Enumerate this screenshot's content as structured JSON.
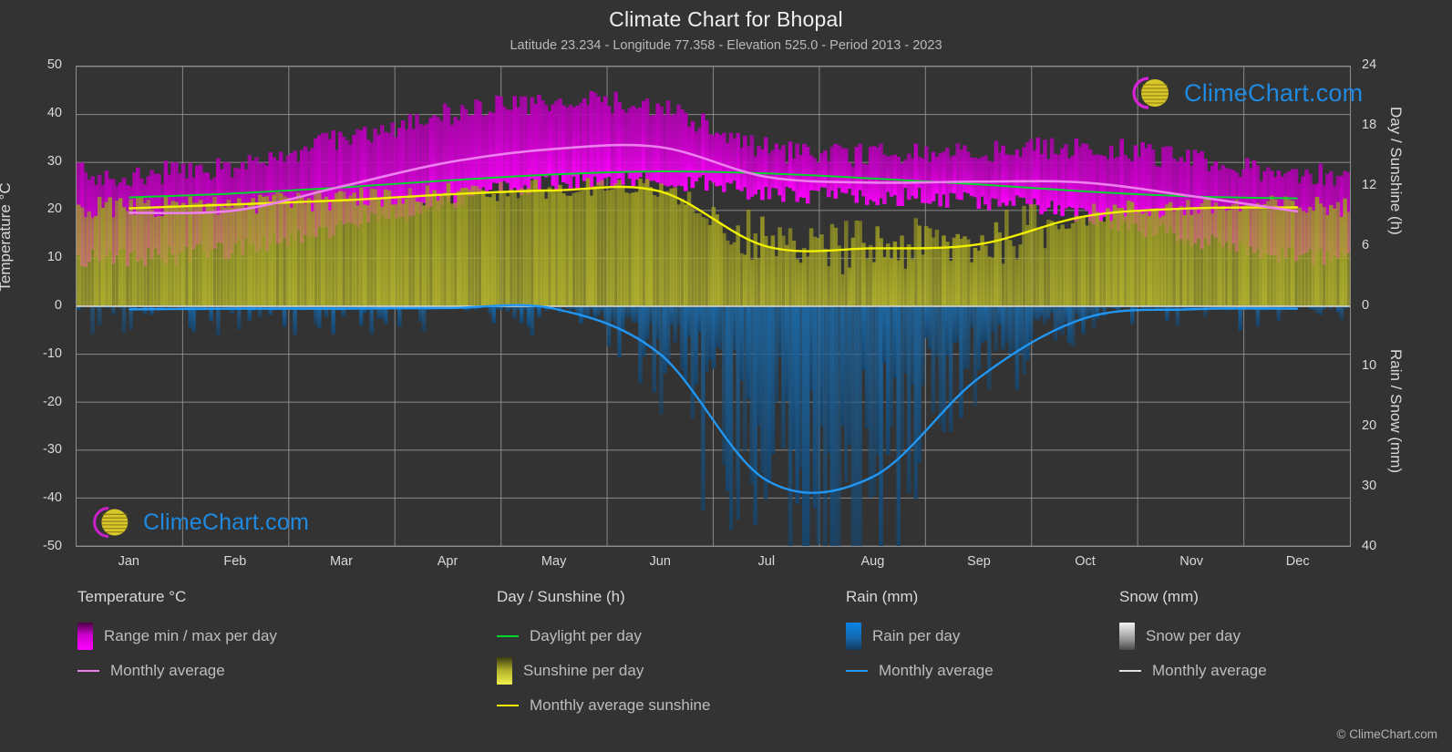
{
  "header": {
    "title": "Climate Chart for Bhopal",
    "subtitle": "Latitude 23.234 - Longitude 77.358 - Elevation 525.0 - Period 2013 - 2023"
  },
  "axes": {
    "left_title": "Temperature °C",
    "right_title_top": "Day / Sunshine (h)",
    "right_title_bottom": "Rain / Snow (mm)",
    "left_ticks": [
      "50",
      "40",
      "30",
      "20",
      "10",
      "0",
      "-10",
      "-20",
      "-30",
      "-40",
      "-50"
    ],
    "right_ticks_top": [
      "24",
      "18",
      "12",
      "6",
      "0"
    ],
    "right_ticks_bottom": [
      "10",
      "20",
      "30",
      "40"
    ],
    "x_ticks": [
      "Jan",
      "Feb",
      "Mar",
      "Apr",
      "May",
      "Jun",
      "Jul",
      "Aug",
      "Sep",
      "Oct",
      "Nov",
      "Dec"
    ]
  },
  "legend": {
    "groups": [
      {
        "title": "Temperature °C",
        "items": [
          {
            "label": "Range min / max per day",
            "marker": "gradient-box",
            "color": "#ff00ff"
          },
          {
            "label": "Monthly average",
            "marker": "line",
            "color": "#ee7fee"
          }
        ]
      },
      {
        "title": "Day / Sunshine (h)",
        "items": [
          {
            "label": "Daylight per day",
            "marker": "line",
            "color": "#00d92b"
          },
          {
            "label": "Sunshine per day",
            "marker": "gradient-box",
            "color": "#f2f24d"
          },
          {
            "label": "Monthly average sunshine",
            "marker": "line",
            "color": "#f0f000"
          }
        ]
      },
      {
        "title": "Rain (mm)",
        "items": [
          {
            "label": "Rain per day",
            "marker": "gradient-box",
            "color": "#0a84e8"
          },
          {
            "label": "Monthly average",
            "marker": "line",
            "color": "#2196f3"
          }
        ]
      },
      {
        "title": "Snow (mm)",
        "items": [
          {
            "label": "Snow per day",
            "marker": "gradient-box",
            "color": "#e8e8e8"
          },
          {
            "label": "Monthly average",
            "marker": "line",
            "color": "#e0e0e0"
          }
        ]
      }
    ]
  },
  "watermark": {
    "text": "ClimeChart.com"
  },
  "footer": {
    "copyright": "© ClimeChart.com"
  },
  "chart_data": {
    "type": "area",
    "title": "Climate Chart for Bhopal",
    "subtitle": "Latitude 23.234 - Longitude 77.358 - Elevation 525.0 - Period 2013 - 2023",
    "xlabel": "",
    "ylabel": "Temperature °C",
    "categories": [
      "Jan",
      "Feb",
      "Mar",
      "Apr",
      "May",
      "Jun",
      "Jul",
      "Aug",
      "Sep",
      "Oct",
      "Nov",
      "Dec"
    ],
    "ylim": [
      -50,
      50
    ],
    "y2lim_top_hours": [
      0,
      24
    ],
    "y2lim_bottom_mm": [
      0,
      40
    ],
    "grid": true,
    "legend_position": "below",
    "series": [
      {
        "name": "Monthly average temperature",
        "unit": "°C",
        "axis": "left",
        "color": "#ee7fee",
        "values": [
          19.5,
          20.0,
          25.0,
          30.0,
          32.8,
          33.2,
          27.0,
          25.8,
          26.0,
          25.8,
          23.0,
          19.8
        ]
      },
      {
        "name": "Daily max temperature (range top)",
        "unit": "°C",
        "axis": "left",
        "color": "#ff00ff",
        "values": [
          27.5,
          29.5,
          35.0,
          40.0,
          42.5,
          41.0,
          33.0,
          31.5,
          32.5,
          33.0,
          30.5,
          27.5
        ]
      },
      {
        "name": "Daily min temperature (range bottom)",
        "unit": "°C",
        "axis": "left",
        "color": "#ff00ff",
        "values": [
          10.0,
          12.0,
          16.5,
          22.0,
          26.0,
          26.5,
          23.5,
          23.0,
          22.0,
          19.0,
          14.0,
          10.5
        ]
      },
      {
        "name": "Daylight per day",
        "unit": "h",
        "axis": "right-top",
        "color": "#00d92b",
        "values": [
          10.9,
          11.3,
          11.9,
          12.6,
          13.2,
          13.5,
          13.3,
          12.8,
          12.2,
          11.5,
          11.0,
          10.8
        ]
      },
      {
        "name": "Monthly average sunshine",
        "unit": "h",
        "axis": "right-top",
        "color": "#f0f000",
        "values": [
          9.8,
          10.2,
          10.6,
          11.2,
          11.6,
          11.5,
          6.0,
          5.8,
          6.2,
          9.0,
          9.8,
          9.9
        ]
      },
      {
        "name": "Rain monthly average",
        "unit": "mm",
        "axis": "right-bottom",
        "color": "#2196f3",
        "values": [
          0.5,
          0.4,
          0.4,
          0.3,
          0.4,
          8.0,
          29.0,
          28.5,
          12.0,
          2.0,
          0.5,
          0.4
        ]
      },
      {
        "name": "Snow monthly average",
        "unit": "mm",
        "axis": "right-bottom",
        "color": "#e0e0e0",
        "values": [
          0,
          0,
          0,
          0,
          0,
          0,
          0,
          0,
          0,
          0,
          0,
          0
        ]
      }
    ]
  }
}
